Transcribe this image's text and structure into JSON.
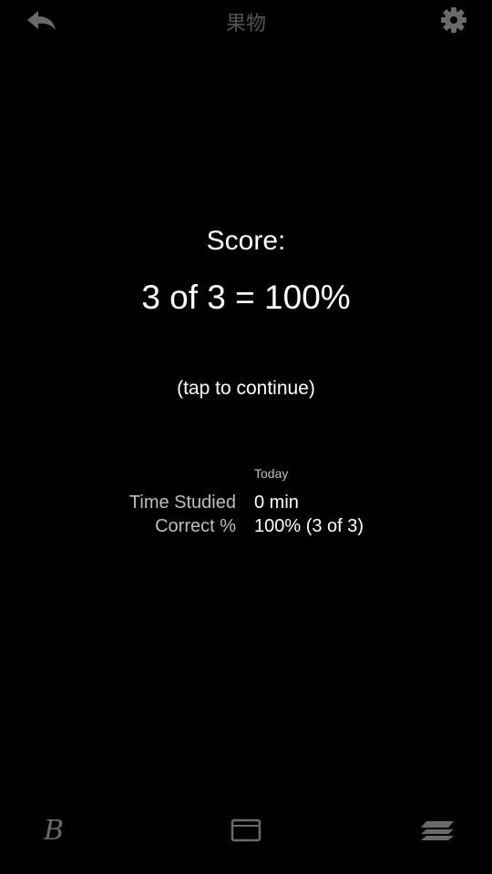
{
  "header": {
    "deck_title": "果物",
    "back_icon": "back-arrow-icon",
    "settings_icon": "gear-icon"
  },
  "score": {
    "label": "Score:",
    "value": "3 of 3 = 100%",
    "tap_hint": "(tap to continue)"
  },
  "stats": {
    "column_header": "Today",
    "rows": [
      {
        "label": "Time Studied",
        "value": "0 min"
      },
      {
        "label": "Correct %",
        "value": "100% (3 of 3)"
      }
    ]
  },
  "bottom_bar": {
    "left_glyph": "B",
    "left_icon": "bold-b-icon",
    "center_icon": "card-icon",
    "right_icon": "card-stack-icon"
  },
  "colors": {
    "background": "#000000",
    "icon_gray": "#6a6a6a",
    "title_gray": "#555555",
    "label_gray": "#bdbdbd",
    "text_white": "#ffffff"
  }
}
